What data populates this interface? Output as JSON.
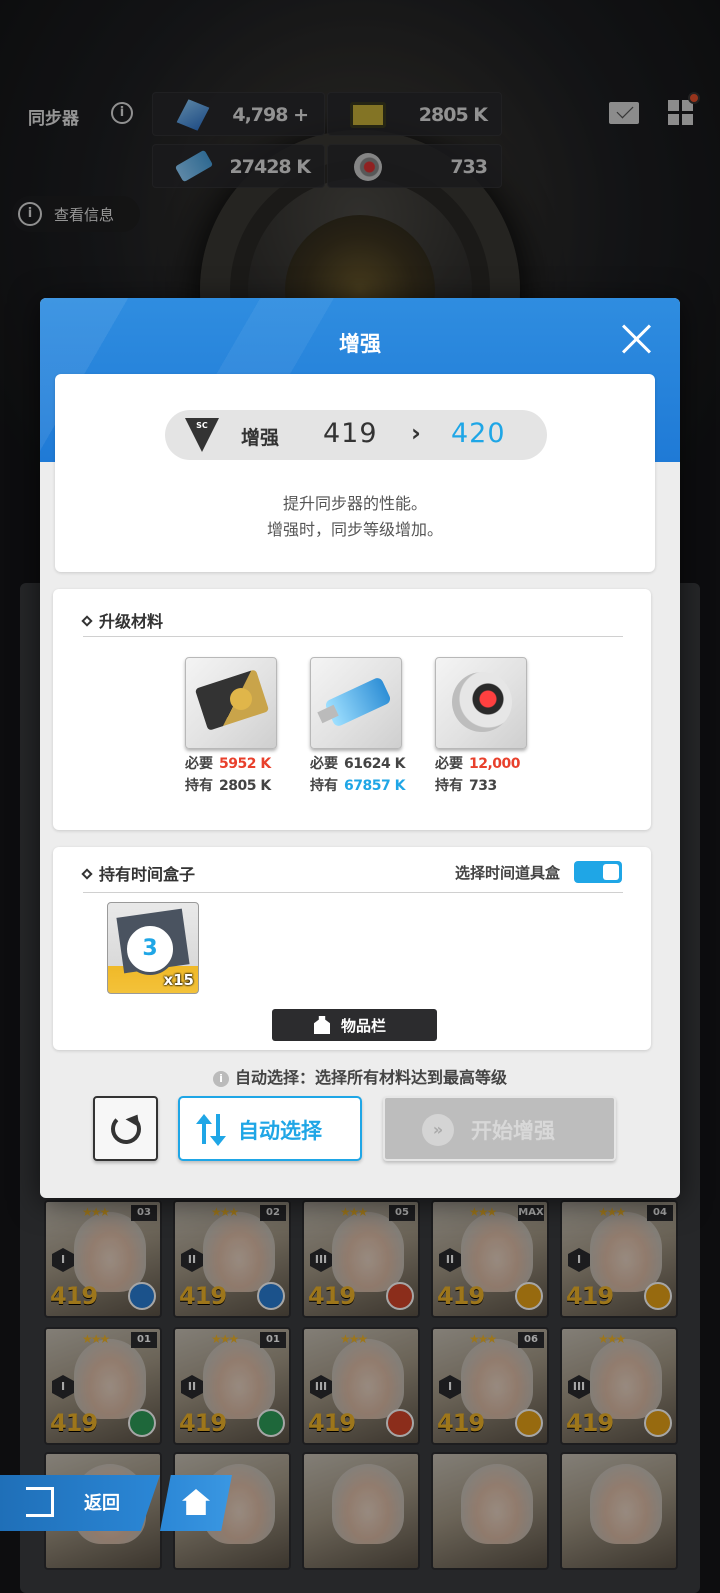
{
  "topbar": {
    "title": "同步器",
    "resources": [
      {
        "icon": "blue-crystal-icon",
        "value": "4,798",
        "plus": "+"
      },
      {
        "icon": "credit-card-icon",
        "value": "2805 K"
      },
      {
        "icon": "usb-drive-icon",
        "value": "27428 K"
      },
      {
        "icon": "core-orb-icon",
        "value": "733"
      }
    ],
    "view_info_label": "查看信息"
  },
  "modal": {
    "title": "增强",
    "level": {
      "badge_text": "SC",
      "label": "增强",
      "from": "419",
      "arrow": "›",
      "to": "420"
    },
    "description": [
      "提升同步器的性能。",
      "增强时，同步等级增加。"
    ],
    "materials_section": {
      "title": "升级材料",
      "items": [
        {
          "icon": "credit-card-icon",
          "required_label": "必要",
          "required": "5952 K",
          "owned_label": "持有",
          "owned": "2805 K",
          "required_color": "#e8402c"
        },
        {
          "icon": "usb-drive-icon",
          "required_label": "必要",
          "required": "61624 K",
          "owned_label": "持有",
          "owned": "67857 K",
          "owned_color": "#1fa6e6"
        },
        {
          "icon": "core-orb-icon",
          "required_label": "必要",
          "required": "12,000",
          "owned_label": "持有",
          "owned": "733",
          "required_color": "#e8402c"
        }
      ]
    },
    "timebox_section": {
      "title": "持有时间盒子",
      "toggle_label": "选择时间道具盒",
      "toggle_on": true,
      "box": {
        "hours": "3",
        "quantity": "x15"
      },
      "inventory_label": "物品栏"
    },
    "hint": "自动选择：选择所有材料达到最高等级",
    "buttons": {
      "auto_select": "自动选择",
      "start": "开始增强"
    }
  },
  "character_cards": [
    {
      "rank": "I",
      "level": "419",
      "badge": "03",
      "element_color": "#2a7fd6"
    },
    {
      "rank": "II",
      "level": "419",
      "badge": "02",
      "element_color": "#2a7fd6"
    },
    {
      "rank": "III",
      "level": "419",
      "badge": "05",
      "element_color": "#d6452a"
    },
    {
      "rank": "II",
      "level": "419",
      "badge": "MAX",
      "element_color": "#e8a418"
    },
    {
      "rank": "I",
      "level": "419",
      "badge": "04",
      "element_color": "#e8a418"
    },
    {
      "rank": "I",
      "level": "419",
      "badge": "01",
      "element_color": "#2f9e5a"
    },
    {
      "rank": "II",
      "level": "419",
      "badge": "01",
      "element_color": "#2f9e5a"
    },
    {
      "rank": "III",
      "level": "419",
      "badge": "",
      "element_color": "#d6452a"
    },
    {
      "rank": "I",
      "level": "419",
      "badge": "06",
      "element_color": "#e8a418"
    },
    {
      "rank": "III",
      "level": "419",
      "badge": "",
      "element_color": "#e8a418"
    }
  ],
  "bottom_nav": {
    "back_label": "返回"
  }
}
